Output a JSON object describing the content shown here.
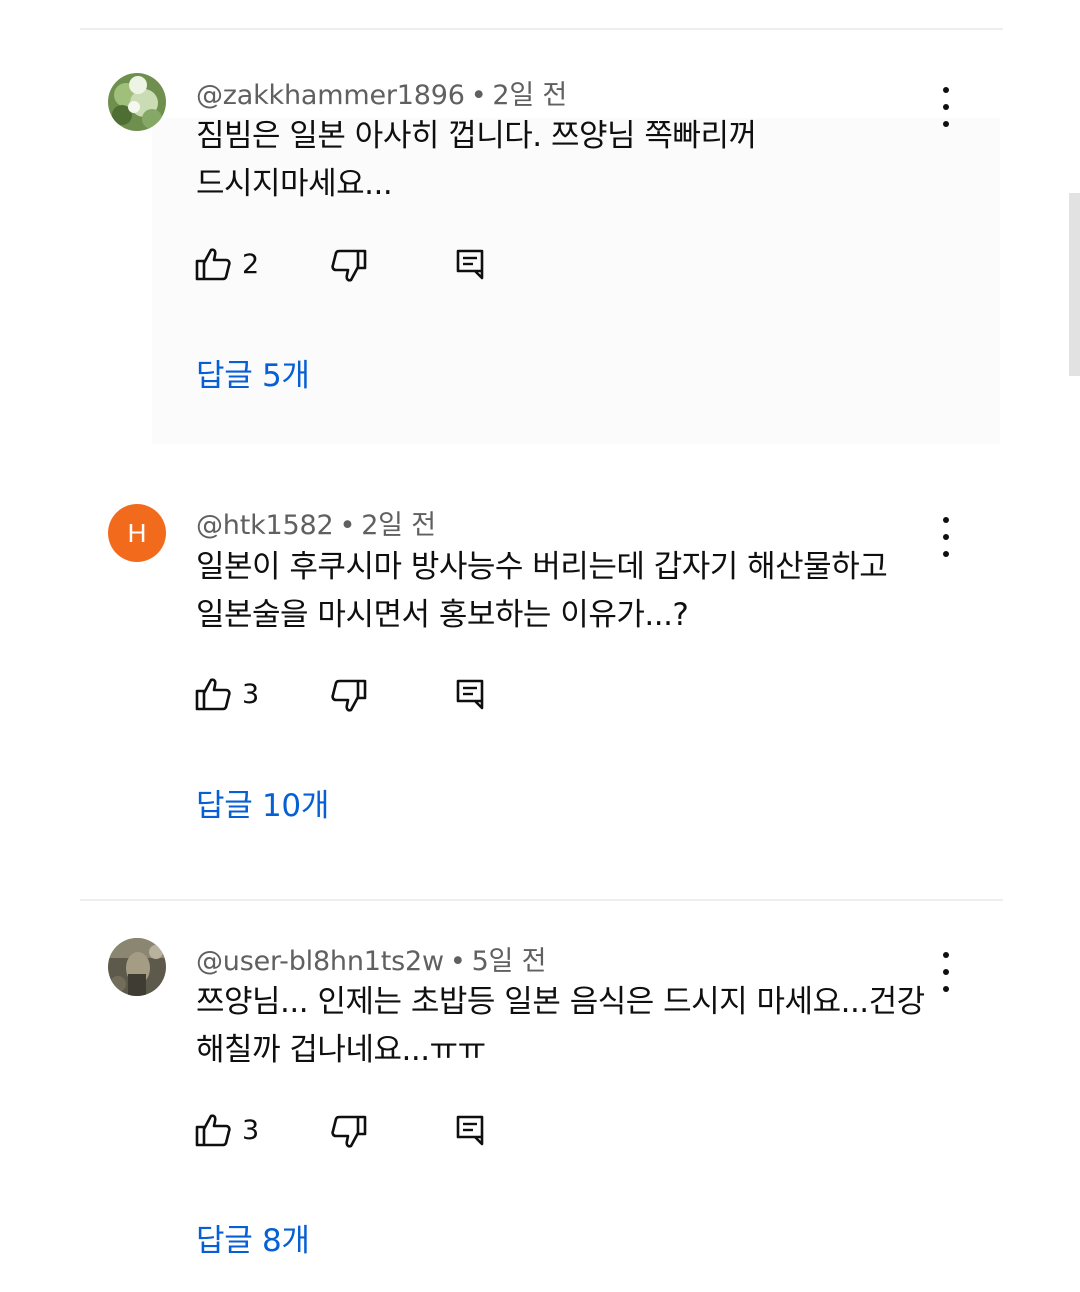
{
  "comments": [
    {
      "author": "@zakkhammer1896",
      "time": "2일 전",
      "body_line1": "짐빔은 일본 아사히 껍니다. 쯔양님 쪽빠리꺼",
      "body_line2": "드시지마세요...",
      "likes": "2",
      "replies_label": "답글 5개"
    },
    {
      "author": "@htk1582",
      "avatar_letter": "H",
      "time": "2일 전",
      "body_line1": "일본이 후쿠시마 방사능수 버리는데 갑자기 해산물하고",
      "body_line2": "일본술을 마시면서 홍보하는 이유가...?",
      "likes": "3",
      "replies_label": "답글 10개"
    },
    {
      "author": "@user-bl8hn1ts2w",
      "time": "5일 전",
      "body_line1": "쯔양님... 인제는 초밥등 일본 음식은 드시지 마세요...건강",
      "body_line2": "해칠까 겁나네요...ㅠㅠ",
      "likes": "3",
      "replies_label": "답글 8개"
    }
  ],
  "meta_separator": "•",
  "colors": {
    "link": "#065fd4",
    "meta": "#606060",
    "avatar_orange": "#f26b1d"
  }
}
